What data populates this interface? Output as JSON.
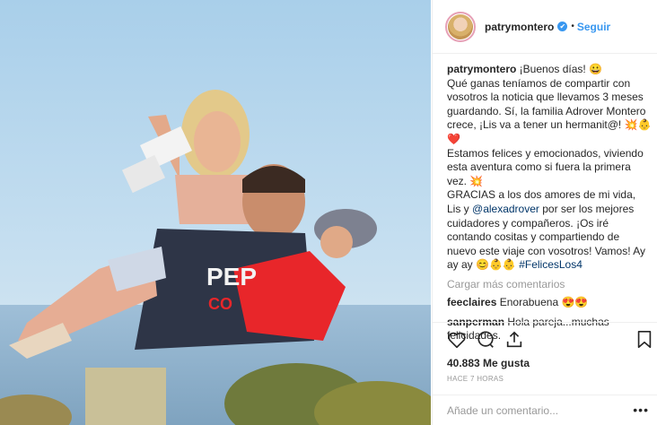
{
  "post": {
    "username": "patrymontero",
    "verified_mark": "✔",
    "separator": "•",
    "follow_label": "Seguir"
  },
  "caption": {
    "user": "patrymontero",
    "line1": " ¡Buenos días! 😀",
    "body1": "Qué ganas teníamos de compartir con vosotros la noticia que llevamos 3 meses guardando. Sí, la familia Adrover Montero crece, ¡Lis va a tener un hermanit@! 💥👶❤️",
    "body2": "Estamos felices y emocionados, viviendo esta aventura como si fuera la primera vez. 💥",
    "body3a": "GRACIAS a los dos amores de mi vida, Lis y ",
    "mention": "@alexadrover",
    "body3b": " por ser los mejores cuidadores y compañeros. ¡Os iré contando cositas y compartiendo de nuevo este viaje con vosotros! Vamos! Ay ay ay 😊👶👶 ",
    "hashtag": "#FelicesLos4"
  },
  "load_more": "Cargar más comentarios",
  "comments": [
    {
      "user": "feeclaires",
      "text": " Enorabuena 😍😍"
    },
    {
      "user": "sanperman",
      "text": " Hola pareja...muchas felicidades."
    }
  ],
  "likes": "40.883 Me gusta",
  "time": "HACE 7 HORAS",
  "add_comment": {
    "placeholder": "Añade un comentario...",
    "more": "•••"
  },
  "photo": {
    "shirt_text": "PEP",
    "shirt_subtext": "CO"
  }
}
